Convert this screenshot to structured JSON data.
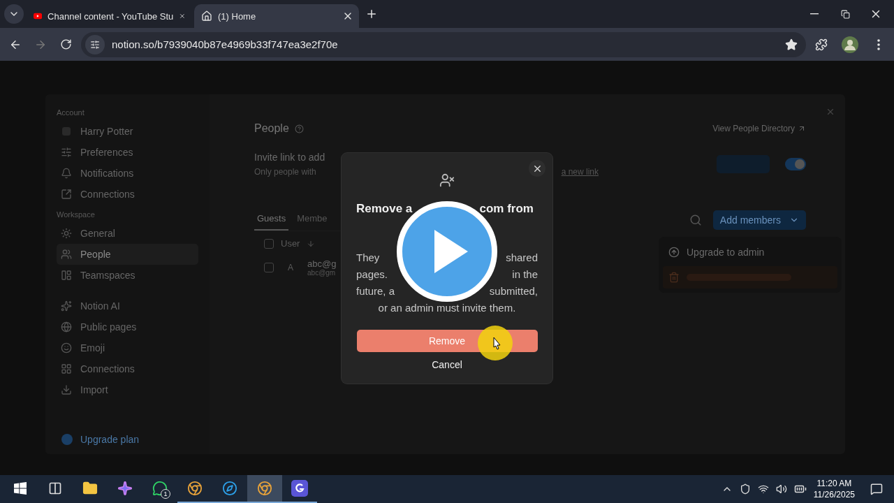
{
  "browser": {
    "tabs": [
      {
        "title": "Channel content - YouTube Stu",
        "selected": false,
        "kind": "video"
      },
      {
        "title": "(1) Home",
        "selected": true,
        "kind": "home"
      }
    ],
    "url": "notion.so/b7939040b87e4969b33f747ea3e2f70e",
    "bookmarked": true
  },
  "settings": {
    "sidebar": {
      "sections": [
        {
          "heading": "Account",
          "items": [
            {
              "label": "Harry Potter",
              "selected": false
            },
            {
              "label": "Preferences",
              "selected": false
            },
            {
              "label": "Notifications",
              "selected": false
            },
            {
              "label": "Connections",
              "selected": false
            }
          ]
        },
        {
          "heading": "Workspace",
          "items": [
            {
              "label": "General",
              "selected": false
            },
            {
              "label": "People",
              "selected": true
            },
            {
              "label": "Teamspaces",
              "selected": false
            }
          ]
        },
        {
          "items": [
            {
              "label": "Notion AI",
              "selected": false
            },
            {
              "label": "Public pages",
              "selected": false
            },
            {
              "label": "Emoji",
              "selected": false
            },
            {
              "label": "Connections",
              "selected": false
            },
            {
              "label": "Import",
              "selected": false
            }
          ]
        }
      ],
      "upgrade": "Upgrade plan"
    },
    "title": "People",
    "directory_link": "View People Directory",
    "invite_title": "Invite link to add",
    "invite_hint": "Only people with",
    "invite_link": "a new link",
    "invite_on": true,
    "tabs": [
      {
        "label": "Guests",
        "selected": true
      },
      {
        "label": "Membe",
        "selected": false
      }
    ],
    "column": "User",
    "all_checked": false,
    "rows": [
      {
        "initial": "A",
        "name": "abc@g",
        "email": "abc@gm",
        "checked": false
      }
    ],
    "add_members": "Add members",
    "menu": [
      {
        "kind": "upgrade",
        "label": "Upgrade to admin"
      },
      {
        "kind": "remove"
      }
    ]
  },
  "dialog": {
    "title": [
      "Remove a",
      "com from"
    ],
    "body": [
      [
        "They",
        "shared"
      ],
      [
        "pages.",
        "in the"
      ],
      [
        "future, a",
        "submitted,"
      ],
      [
        "or an admin must invite them."
      ]
    ],
    "confirm": "Remove",
    "cancel": "Cancel"
  },
  "taskbar": {
    "apps": [
      {
        "running": false,
        "selected": false
      },
      {
        "running": false,
        "selected": false
      },
      {
        "running": false,
        "selected": false
      },
      {
        "running": false,
        "selected": false,
        "badge": "1"
      },
      {
        "running": true,
        "selected": false
      },
      {
        "running": true,
        "selected": false
      },
      {
        "running": true,
        "selected": true
      },
      {
        "running": true,
        "selected": false
      }
    ],
    "time": "11:20 AM",
    "date": "11/26/2025"
  }
}
